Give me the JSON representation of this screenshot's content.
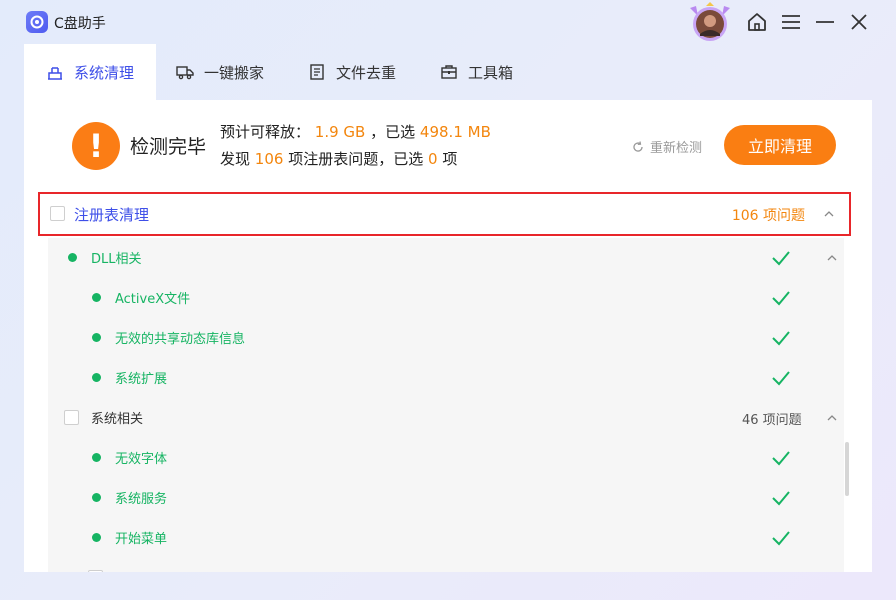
{
  "app": {
    "title": "C盘助手"
  },
  "titlebar": {
    "icons": [
      "home-icon",
      "menu-icon",
      "minimize-icon",
      "close-icon"
    ]
  },
  "tabs": [
    {
      "label": "系统清理",
      "icon": "clean-icon",
      "active": true
    },
    {
      "label": "一键搬家",
      "icon": "truck-icon",
      "active": false
    },
    {
      "label": "文件去重",
      "icon": "file-icon",
      "active": false
    },
    {
      "label": "工具箱",
      "icon": "toolbox-icon",
      "active": false
    }
  ],
  "summary": {
    "status": "检测完毕",
    "line1_prefix": "预计可释放：",
    "releasable": "1.9 GB",
    "line1_mid": "，已选",
    "selected_size": "498.1 MB",
    "line2_prefix": "发现",
    "issues_found": "106",
    "line2_mid": "项注册表问题，已选",
    "issues_selected": "0",
    "line2_suffix": "项",
    "rescan_label": "重新检测",
    "clean_button": "立即清理"
  },
  "category": {
    "label": "注册表清理",
    "count": "106 项问题"
  },
  "rows": [
    {
      "label": "DLL相关",
      "level": 1,
      "type": "dot",
      "checked_ok": true,
      "chevron": true
    },
    {
      "label": "ActiveX文件",
      "level": 2,
      "type": "dot",
      "checked_ok": true
    },
    {
      "label": "无效的共享动态库信息",
      "level": 2,
      "type": "dot",
      "checked_ok": true
    },
    {
      "label": "系统扩展",
      "level": 2,
      "type": "dot",
      "checked_ok": true
    },
    {
      "label": "系统相关",
      "level": 1,
      "type": "checkbox",
      "count": "46 项问题",
      "chevron": true
    },
    {
      "label": "无效字体",
      "level": 2,
      "type": "dot",
      "checked_ok": true
    },
    {
      "label": "系统服务",
      "level": 2,
      "type": "dot",
      "checked_ok": true
    },
    {
      "label": "开始菜单",
      "level": 2,
      "type": "dot",
      "checked_ok": true
    }
  ],
  "colors": {
    "accent": "#3e4fe8",
    "orange": "#fa7e12",
    "green": "#16b463",
    "highlight_border": "#e8262a"
  }
}
